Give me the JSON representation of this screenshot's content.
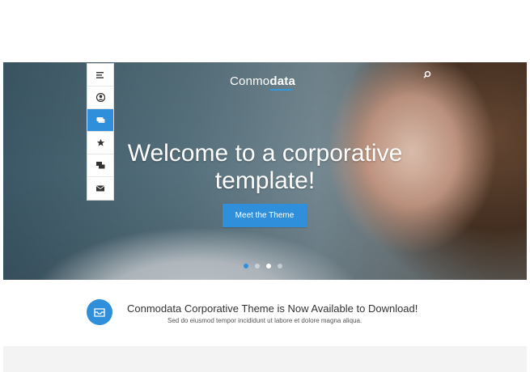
{
  "brand": {
    "logo_light": "Conmo",
    "logo_bold": "data",
    "accent": "#2f8fdb"
  },
  "header": {
    "search_icon": "search-icon"
  },
  "sidebar": {
    "items": [
      {
        "icon": "menu-icon",
        "glyph": "≡"
      },
      {
        "icon": "user-icon",
        "glyph": "●"
      },
      {
        "icon": "chat-bubble-icon",
        "glyph": "▬",
        "active": true
      },
      {
        "icon": "star-icon",
        "glyph": "★"
      },
      {
        "icon": "comments-icon",
        "glyph": "▪"
      },
      {
        "icon": "mail-icon",
        "glyph": "✉"
      }
    ]
  },
  "hero": {
    "title_line1": "Welcome to a corporative",
    "title_line2": "template!",
    "cta_label": "Meet the Theme",
    "slides": 4,
    "active_slide": 3
  },
  "announcement": {
    "icon": "inbox-icon",
    "title": "Conmodata Corporative Theme is Now Available to Download!",
    "subtitle": "Sed do eiusmod tempor incididunt ut labore et dolore magna aliqua."
  }
}
